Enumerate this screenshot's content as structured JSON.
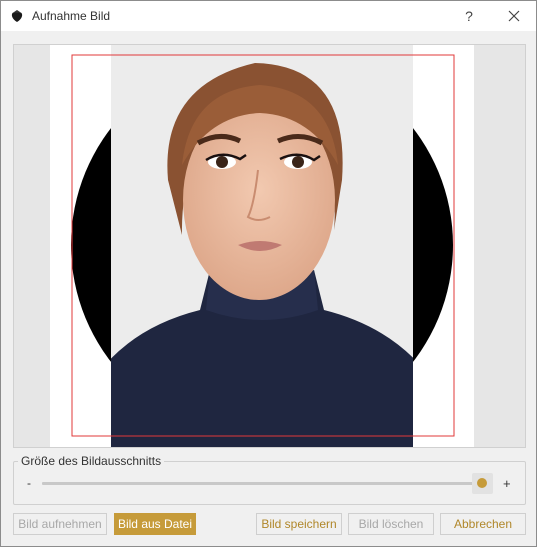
{
  "window": {
    "title": "Aufnahme Bild",
    "help_label": "?"
  },
  "icons": {
    "app": "strawberry-icon",
    "close": "close-icon"
  },
  "colors": {
    "accent": "#c69b3a",
    "accent_text": "#b0872a",
    "crop_frame": "#e0383a",
    "mask": "#000000"
  },
  "crop_size": {
    "title": "Größe des Bildausschnitts",
    "minus_label": "-",
    "plus_label": "+",
    "value_fraction": 1.0
  },
  "buttons": {
    "capture": "Bild aufnehmen",
    "from_file": "Bild aus Datei",
    "save": "Bild speichern",
    "delete": "Bild löschen",
    "cancel": "Abbrechen"
  }
}
